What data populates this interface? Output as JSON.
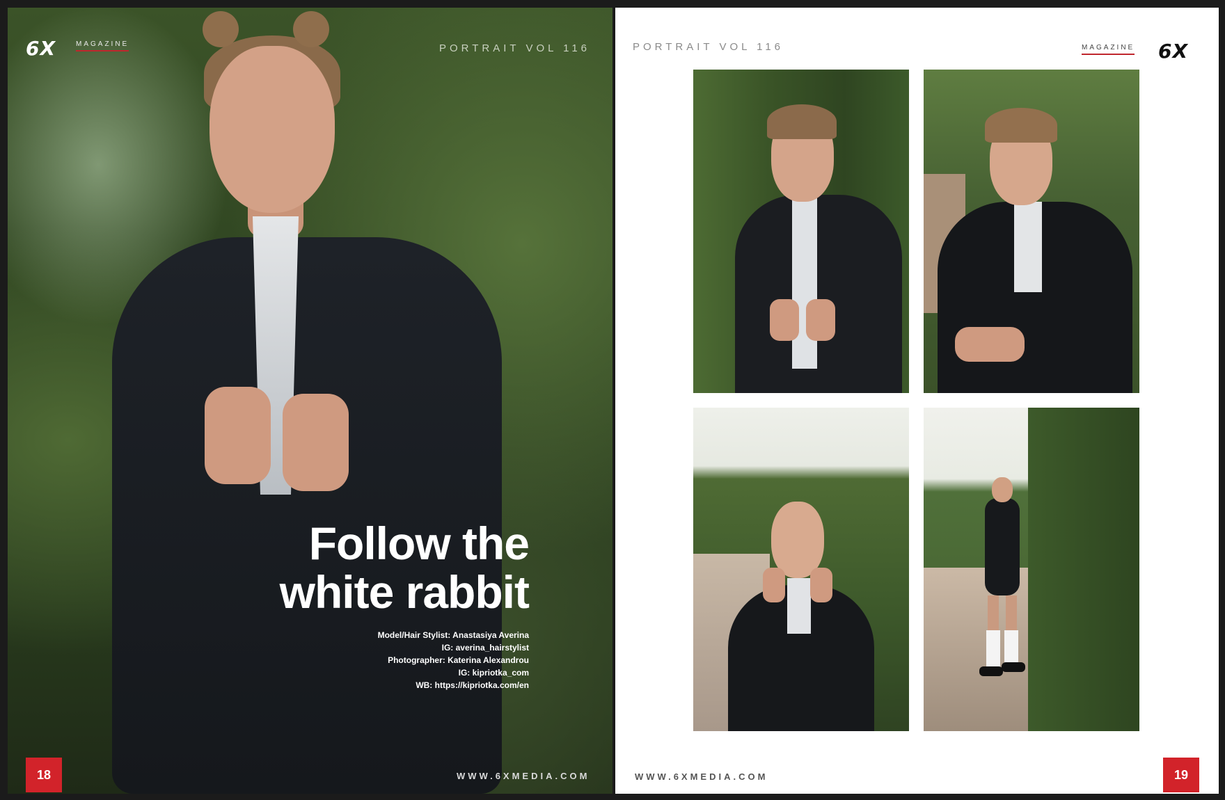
{
  "spread": {
    "left_page": {
      "brand_logo": "6X",
      "brand_sub": "MAGAZINE",
      "running_head": "PORTRAIT VOL 116",
      "title_line1": "Follow the",
      "title_line2": "white rabbit",
      "credits": [
        "Model/Hair Stylist: Anastasiya Averina",
        "IG: averina_hairstylist",
        "Photographer: Katerina Alexandrou",
        "IG: kipriotka_com",
        "WB: https://kipriotka.com/en"
      ],
      "footer_url": "WWW.6XMEDIA.COM",
      "page_number": "18"
    },
    "right_page": {
      "running_head": "PORTRAIT VOL 116",
      "brand_sub": "MAGAZINE",
      "brand_logo": "6X",
      "footer_url": "WWW.6XMEDIA.COM",
      "page_number": "19"
    }
  },
  "colors": {
    "accent_red": "#d2232a",
    "running_head_gray": "#8a8a8a",
    "background": "#1b1b1b"
  }
}
